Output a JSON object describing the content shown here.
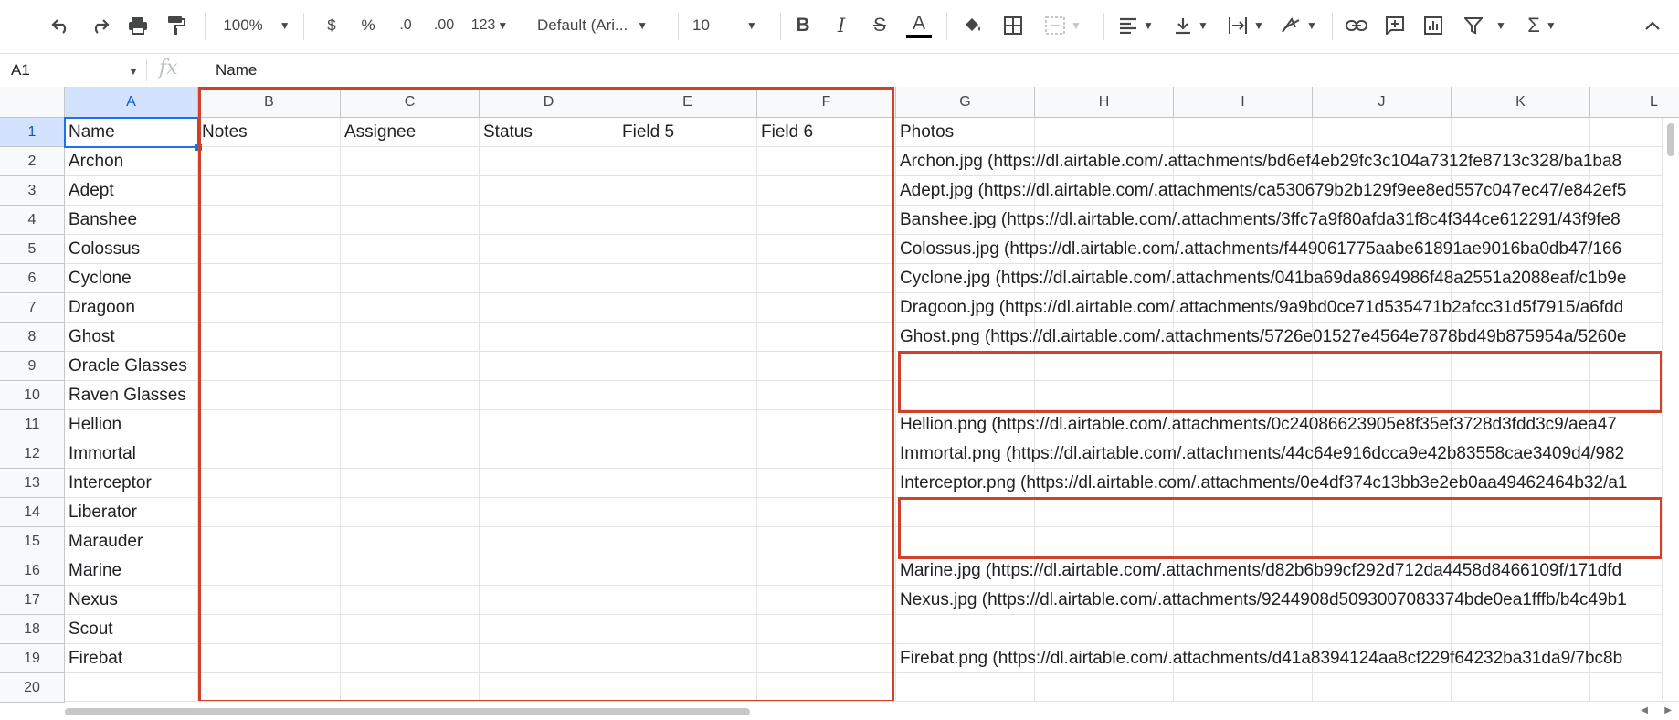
{
  "toolbar": {
    "zoom": "100%",
    "currency": "$",
    "percent": "%",
    "decrease_decimal": ".0",
    "increase_decimal": ".00",
    "more_formats": "123",
    "font": "Default (Ari...",
    "font_size": "10",
    "bold": "B",
    "italic": "I",
    "strike": "S",
    "text_color": "A",
    "text_color_hex": "#000000",
    "icons": [
      "undo-icon",
      "redo-icon",
      "print-icon",
      "paint-format-icon",
      "fill-color-icon",
      "borders-icon",
      "merge-cells-icon",
      "align-icon",
      "vertical-align-icon",
      "text-wrap-icon",
      "text-rotate-icon",
      "link-icon",
      "comment-icon",
      "chart-icon",
      "filter-icon",
      "functions-icon",
      "collapse-icon"
    ]
  },
  "formula_bar": {
    "cell_ref": "A1",
    "fx": "fx",
    "value": "Name"
  },
  "columns": [
    "A",
    "B",
    "C",
    "D",
    "E",
    "F",
    "G",
    "H",
    "I",
    "J",
    "K",
    "L"
  ],
  "rows": [
    "1",
    "2",
    "3",
    "4",
    "5",
    "6",
    "7",
    "8",
    "9",
    "10",
    "11",
    "12",
    "13",
    "14",
    "15",
    "16",
    "17",
    "18",
    "19",
    "20"
  ],
  "header_row": {
    "A": "Name",
    "B": "Notes",
    "C": "Assignee",
    "D": "Status",
    "E": "Field 5",
    "F": "Field 6",
    "G": "Photos"
  },
  "names": [
    "Archon",
    "Adept",
    "Banshee",
    "Colossus",
    "Cyclone",
    "Dragoon",
    "Ghost",
    "Oracle Glasses",
    "Raven Glasses",
    "Hellion",
    "Immortal",
    "Interceptor",
    "Liberator",
    "Marauder",
    "Marine",
    "Nexus",
    "Scout",
    "Firebat",
    ""
  ],
  "photos": [
    "Archon.jpg (https://dl.airtable.com/.attachments/bd6ef4eb29fc3c104a7312fe8713c328/ba1ba8",
    "Adept.jpg (https://dl.airtable.com/.attachments/ca530679b2b129f9ee8ed557c047ec47/e842ef5",
    "Banshee.jpg (https://dl.airtable.com/.attachments/3ffc7a9f80afda31f8c4f344ce612291/43f9fe8",
    "Colossus.jpg (https://dl.airtable.com/.attachments/f449061775aabe61891ae9016ba0db47/166",
    "Cyclone.jpg (https://dl.airtable.com/.attachments/041ba69da8694986f48a2551a2088eaf/c1b9e",
    "Dragoon.jpg (https://dl.airtable.com/.attachments/9a9bd0ce71d535471b2afcc31d5f7915/a6fdd",
    "Ghost.png (https://dl.airtable.com/.attachments/5726e01527e4564e7878bd49b875954a/5260e",
    "",
    "",
    "Hellion.png (https://dl.airtable.com/.attachments/0c24086623905e8f35ef3728d3fdd3c9/aea47",
    "Immortal.png (https://dl.airtable.com/.attachments/44c64e916dcca9e42b83558cae3409d4/982",
    "Interceptor.png (https://dl.airtable.com/.attachments/0e4df374c13bb3e2eb0aa49462464b32/a1",
    "",
    "",
    "Marine.jpg (https://dl.airtable.com/.attachments/d82b6b99cf292d712da4458d8466109f/171dfd",
    "Nexus.jpg (https://dl.airtable.com/.attachments/9244908d5093007083374bde0ea1fffb/b4c49b1",
    "",
    "Firebat.png (https://dl.airtable.com/.attachments/d41a8394124aa8cf229f64232ba31da9/7bc8b",
    ""
  ],
  "colors": {
    "annotation_red": "#d0402a",
    "selection_blue": "#1a73e8",
    "header_bg": "#f8f9fa"
  }
}
